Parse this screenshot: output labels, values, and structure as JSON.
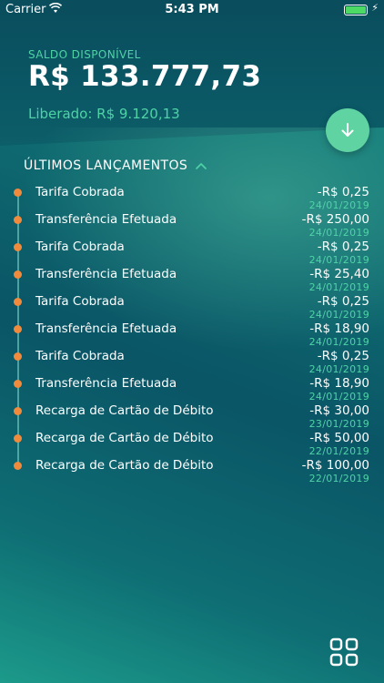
{
  "status": {
    "carrier": "Carrier",
    "time": "5:43 PM"
  },
  "balance": {
    "label": "SALDO DISPONÍVEL",
    "value": "R$ 133.777,73",
    "released": "Liberado: R$ 9.120,13"
  },
  "section_title": "ÚLTIMOS LANÇAMENTOS",
  "transactions": [
    {
      "desc": "Tarifa Cobrada",
      "amount": "-R$ 0,25",
      "date": "24/01/2019"
    },
    {
      "desc": "Transferência Efetuada",
      "amount": "-R$ 250,00",
      "date": "24/01/2019"
    },
    {
      "desc": "Tarifa Cobrada",
      "amount": "-R$ 0,25",
      "date": "24/01/2019"
    },
    {
      "desc": "Transferência Efetuada",
      "amount": "-R$ 25,40",
      "date": "24/01/2019"
    },
    {
      "desc": "Tarifa Cobrada",
      "amount": "-R$ 0,25",
      "date": "24/01/2019"
    },
    {
      "desc": "Transferência Efetuada",
      "amount": "-R$ 18,90",
      "date": "24/01/2019"
    },
    {
      "desc": "Tarifa Cobrada",
      "amount": "-R$ 0,25",
      "date": "24/01/2019"
    },
    {
      "desc": "Transferência Efetuada",
      "amount": "-R$ 18,90",
      "date": "24/01/2019"
    },
    {
      "desc": "Recarga de Cartão de Débito",
      "amount": "-R$ 30,00",
      "date": "23/01/2019"
    },
    {
      "desc": "Recarga de Cartão de Débito",
      "amount": "-R$ 50,00",
      "date": "22/01/2019"
    },
    {
      "desc": "Recarga de Cartão de Débito",
      "amount": "-R$ 100,00",
      "date": "22/01/2019"
    }
  ],
  "icons": {
    "fab": "arrow-down-icon",
    "menu": "grid-icon",
    "collapse": "chevron-up-icon"
  },
  "colors": {
    "accent": "#4fd3a6",
    "dot": "#f08a3c",
    "fab": "#5fd3a2"
  }
}
